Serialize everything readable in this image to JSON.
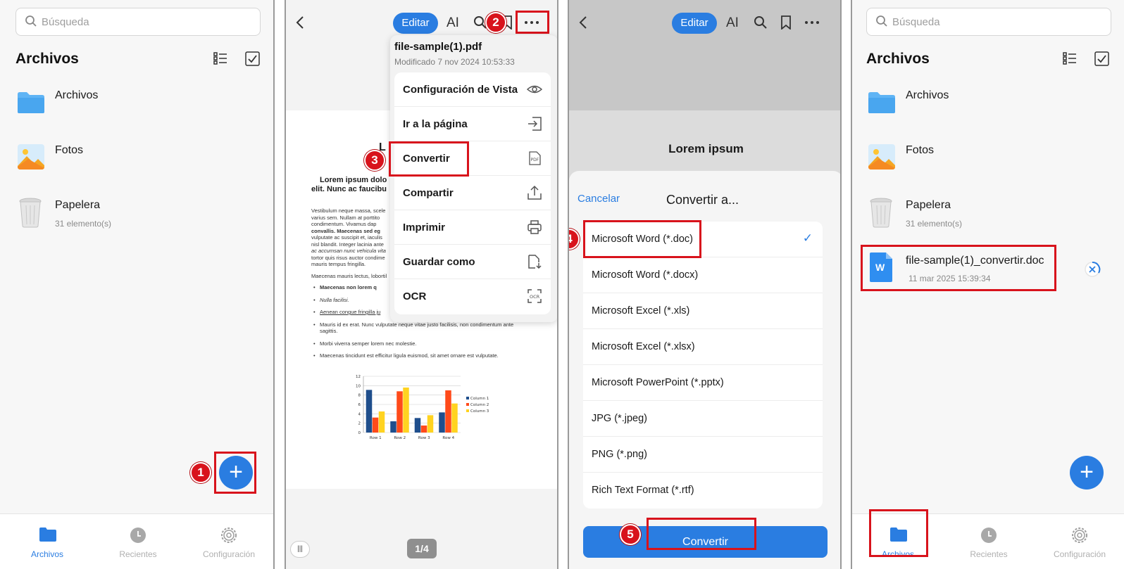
{
  "colors": {
    "accent": "#2a7de1",
    "highlight": "#d8131c"
  },
  "panel1": {
    "search_placeholder": "Búsqueda",
    "title": "Archivos",
    "rows": [
      {
        "name": "Archivos",
        "icon": "folder-icon"
      },
      {
        "name": "Fotos",
        "icon": "photos-icon"
      },
      {
        "name": "Papelera",
        "sub": "31 elemento(s)",
        "icon": "trash-icon"
      }
    ],
    "fab": "+",
    "step": "1",
    "tabs": [
      "Archivos",
      "Recientes",
      "Configuración"
    ]
  },
  "panel2": {
    "edit": "Editar",
    "ai": "AI",
    "step_more": "2",
    "step_convert": "3",
    "menu": {
      "file": "file-sample(1).pdf",
      "modified": "Modificado 7 nov 2024 10:53:33",
      "items": [
        "Configuración de Vista",
        "Ir a la página",
        "Convertir",
        "Compartir",
        "Imprimir",
        "Guardar como",
        "OCR"
      ]
    },
    "doc": {
      "heading_partial": "L",
      "sub1": "Lorem ipsum dolo",
      "sub2": "elit. Nunc ac faucibu",
      "para_lines": [
        "Vestibulum neque massa, scele",
        "varius sem. Nullam at porttito",
        "condimentum. Vivamus dap",
        "convallis. Maecenas sed eg",
        "vulputate ac suscipit et, iaculis",
        "nisl blandit. Integer lacinia ante",
        "ac accumsan nunc vehicula vita",
        "tortor quis risus auctor condime",
        "mauris tempus fringilla."
      ],
      "maecenas": "Maecenas mauris lectus, lobortil",
      "bullets": [
        "Maecenas non lorem q",
        "Nulla facilisi.",
        "Aenean congue fringilla ju",
        "Mauris id ex erat. Nunc vulputate neque vitae justo facilisis, non condimentum ante",
        "sagittis.",
        "Morbi viverra semper lorem nec molestie.",
        "Maecenas tincidunt est efficitur ligula euismod, sit amet ornare est vulputate."
      ]
    },
    "page_indicator": "1/4"
  },
  "chart_data": {
    "type": "bar",
    "categories": [
      "Row 1",
      "Row 2",
      "Row 3",
      "Row 4"
    ],
    "series": [
      {
        "name": "Column 1",
        "values": [
          9.1,
          2.4,
          3.1,
          4.3
        ],
        "color": "#1f4e8c"
      },
      {
        "name": "Column 2",
        "values": [
          3.2,
          8.8,
          1.5,
          9.0
        ],
        "color": "#ff4a1a"
      },
      {
        "name": "Column 3",
        "values": [
          4.5,
          9.6,
          3.7,
          6.2
        ],
        "color": "#ffd320"
      }
    ],
    "ylim": [
      0,
      12
    ],
    "yticks": [
      0,
      2,
      4,
      6,
      8,
      10,
      12
    ],
    "legend": "right",
    "grid": true
  },
  "panel3": {
    "edit": "Editar",
    "ai": "AI",
    "doc_title": "Lorem ipsum",
    "cancel": "Cancelar",
    "sheet_title": "Convertir a...",
    "options": [
      "Microsoft Word (*.doc)",
      "Microsoft Word (*.docx)",
      "Microsoft Excel (*.xls)",
      "Microsoft Excel (*.xlsx)",
      "Microsoft PowerPoint (*.pptx)",
      "JPG (*.jpeg)",
      "PNG (*.png)",
      "Rich Text Format (*.rtf)"
    ],
    "selected": "Microsoft Word (*.doc)",
    "check": "✓",
    "convert": "Convertir",
    "step_option": "4",
    "step_convert": "5"
  },
  "panel4": {
    "search_placeholder": "Búsqueda",
    "title": "Archivos",
    "rows": [
      {
        "name": "Archivos"
      },
      {
        "name": "Fotos"
      },
      {
        "name": "Papelera",
        "sub": "31 elemento(s)"
      }
    ],
    "new_file": {
      "name": "file-sample(1)_convertir.doc",
      "date": "11 mar 2025 15:39:34",
      "letter": "W"
    },
    "fab": "+",
    "tabs": [
      "Archivos",
      "Recientes",
      "Configuración"
    ]
  }
}
